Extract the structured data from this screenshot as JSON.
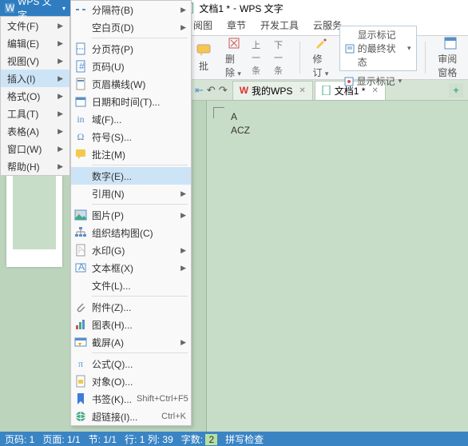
{
  "title": {
    "doc": "文档1 *",
    "app": "WPS 文字"
  },
  "app_menu": "WPS 文字",
  "menubar": [
    {
      "label": "文件(F)"
    },
    {
      "label": "编辑(E)"
    },
    {
      "label": "视图(V)"
    },
    {
      "label": "插入(I)",
      "sel": true
    },
    {
      "label": "格式(O)"
    },
    {
      "label": "工具(T)"
    },
    {
      "label": "表格(A)"
    },
    {
      "label": "窗口(W)"
    },
    {
      "label": "帮助(H)"
    }
  ],
  "submenu": [
    {
      "ico": "sep",
      "label": "分隔符(B)",
      "arrow": true
    },
    {
      "ico": "blank",
      "label": "空白页(D)",
      "arrow": true
    },
    {
      "sep": true
    },
    {
      "ico": "pgbrk",
      "label": "分页符(P)"
    },
    {
      "ico": "pgnum",
      "label": "页码(U)"
    },
    {
      "ico": "hline",
      "label": "页眉横线(W)"
    },
    {
      "ico": "date",
      "label": "日期和时间(T)..."
    },
    {
      "ico": "field",
      "label": "域(F)..."
    },
    {
      "ico": "sym",
      "label": "符号(S)..."
    },
    {
      "ico": "note",
      "label": "批注(M)"
    },
    {
      "sep": true
    },
    {
      "ico": "",
      "label": "数字(E)...",
      "sel": true
    },
    {
      "ico": "",
      "label": "引用(N)",
      "arrow": true
    },
    {
      "sep": true
    },
    {
      "ico": "pic",
      "label": "图片(P)",
      "arrow": true
    },
    {
      "ico": "org",
      "label": "组织结构图(C)"
    },
    {
      "ico": "wm",
      "label": "水印(G)",
      "arrow": true
    },
    {
      "ico": "tbox",
      "label": "文本框(X)",
      "arrow": true
    },
    {
      "ico": "",
      "label": "文件(L)..."
    },
    {
      "sep": true
    },
    {
      "ico": "att",
      "label": "附件(Z)..."
    },
    {
      "ico": "chart",
      "label": "图表(H)..."
    },
    {
      "ico": "snap",
      "label": "截屏(A)",
      "arrow": true
    },
    {
      "sep": true
    },
    {
      "ico": "eq",
      "label": "公式(Q)..."
    },
    {
      "ico": "obj",
      "label": "对象(O)..."
    },
    {
      "ico": "bm",
      "label": "书签(K)...",
      "shortcut": "Shift+Ctrl+F5"
    },
    {
      "ico": "link",
      "label": "超链接(I)...",
      "shortcut": "Ctrl+K"
    }
  ],
  "ribbon_tabs": [
    "阅图",
    "章节",
    "开发工具",
    "云服务"
  ],
  "ribbon": {
    "review": "批",
    "delete": "删除",
    "prev": "上一条",
    "next": "下一条",
    "track": "修订",
    "track_arrow": "▾",
    "track_state": "显示标记的最终状态",
    "show_marks": "显示标记",
    "pane": "审阅窗格"
  },
  "doc_tabs": {
    "home": "我的WPS",
    "doc": "文档1 *"
  },
  "page_text": {
    "l1": "A",
    "l2": "ACZ"
  },
  "status": {
    "page": "页码: 1",
    "pages": "页面: 1/1",
    "sect": "节: 1/1",
    "rc": "行: 1  列: 39",
    "words_lbl": "字数:",
    "words": "2",
    "spell": "拼写检查"
  }
}
